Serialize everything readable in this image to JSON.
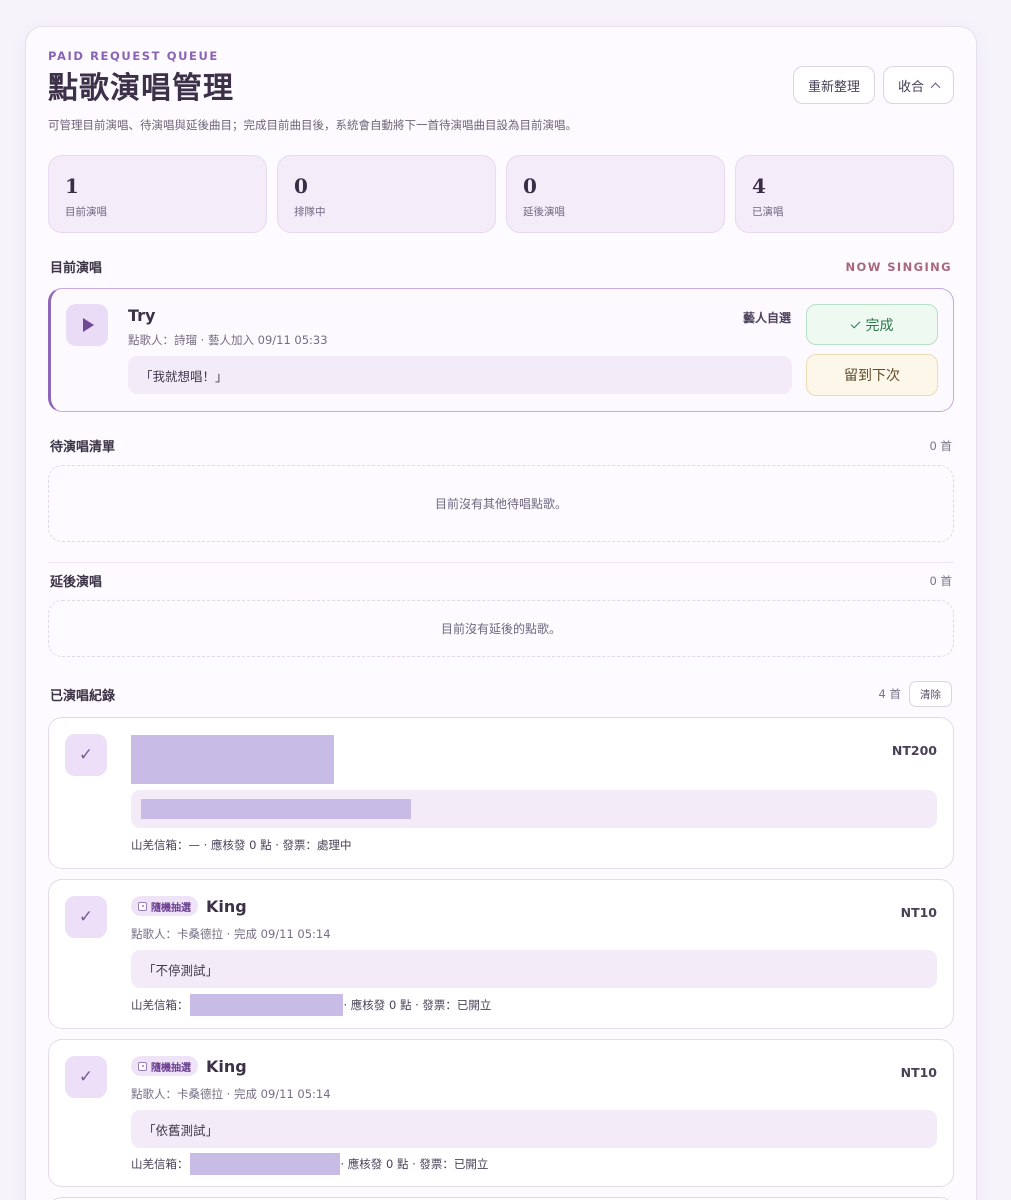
{
  "header": {
    "eyebrow": "PAID REQUEST QUEUE",
    "title": "點歌演唱管理",
    "subtitle": "可管理目前演唱、待演唱與延後曲目；完成目前曲目後，系統會自動將下一首待演唱曲目設為目前演唱。",
    "refresh_label": "重新整理",
    "collapse_label": "收合"
  },
  "stats": [
    {
      "value": "1",
      "label": "目前演唱"
    },
    {
      "value": "0",
      "label": "排隊中"
    },
    {
      "value": "0",
      "label": "延後演唱"
    },
    {
      "value": "4",
      "label": "已演唱"
    }
  ],
  "current": {
    "section_title": "目前演唱",
    "tag": "NOW SINGING",
    "song": "Try",
    "meta": "點歌人：詩瑠 · 藝人加入 09/11 05:33",
    "source": "藝人自選",
    "note": "「我就想唱！」",
    "done_label": "完成",
    "defer_label": "留到下次"
  },
  "queue": {
    "title": "待演唱清單",
    "count": "0 首",
    "empty": "目前沒有其他待唱點歌。"
  },
  "deferred": {
    "title": "延後演唱",
    "count": "0 首",
    "empty": "目前沒有延後的點歌。"
  },
  "history": {
    "title": "已演唱紀錄",
    "count": "4 首",
    "clear_label": "清除",
    "items": [
      {
        "price": "NT200",
        "footer": "山羌信箱：— · 應核發 0 點 · 發票：處理中"
      },
      {
        "tag": "隨機抽選",
        "song": "King",
        "price": "NT10",
        "meta": "點歌人：卡桑德拉 · 完成 09/11 05:14",
        "note": "「不停測試」",
        "footer_prefix": "山羌信箱：",
        "footer_suffix": " · 應核發 0 點 · 發票：已開立"
      },
      {
        "tag": "隨機抽選",
        "song": "King",
        "price": "NT10",
        "meta": "點歌人：卡桑德拉 · 完成 09/11 05:14",
        "note": "「依舊測試」",
        "footer_prefix": "山羌信箱：",
        "footer_suffix": " · 應核發 0 點 · 發票：已開立"
      }
    ]
  }
}
